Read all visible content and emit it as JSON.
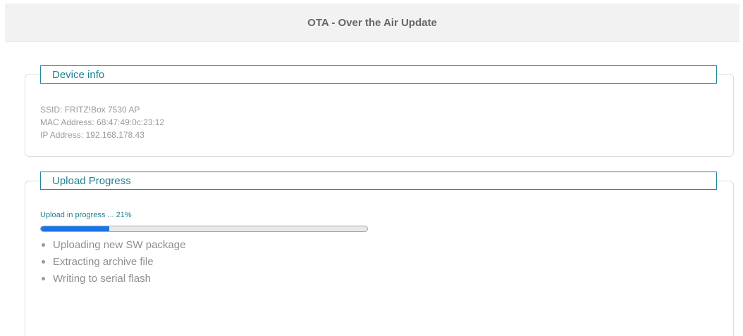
{
  "header": {
    "title": "OTA - Over the Air Update"
  },
  "device_info": {
    "legend": "Device info",
    "lines": [
      "SSID: FRITZ!Box 7530 AP",
      "MAC Address: 68:47:49:0c:23:12",
      "IP Address: 192.168.178.43"
    ]
  },
  "upload": {
    "legend": "Upload Progress",
    "status_text": "Upload in progress ... 21%",
    "progress_percent": 21,
    "steps": [
      "Uploading new SW package",
      "Extracting archive file",
      "Writing to serial flash"
    ]
  },
  "colors": {
    "accent": "#1f7f91",
    "progress_fill": "#1a73e8",
    "header_bg": "#f2f2f2"
  }
}
